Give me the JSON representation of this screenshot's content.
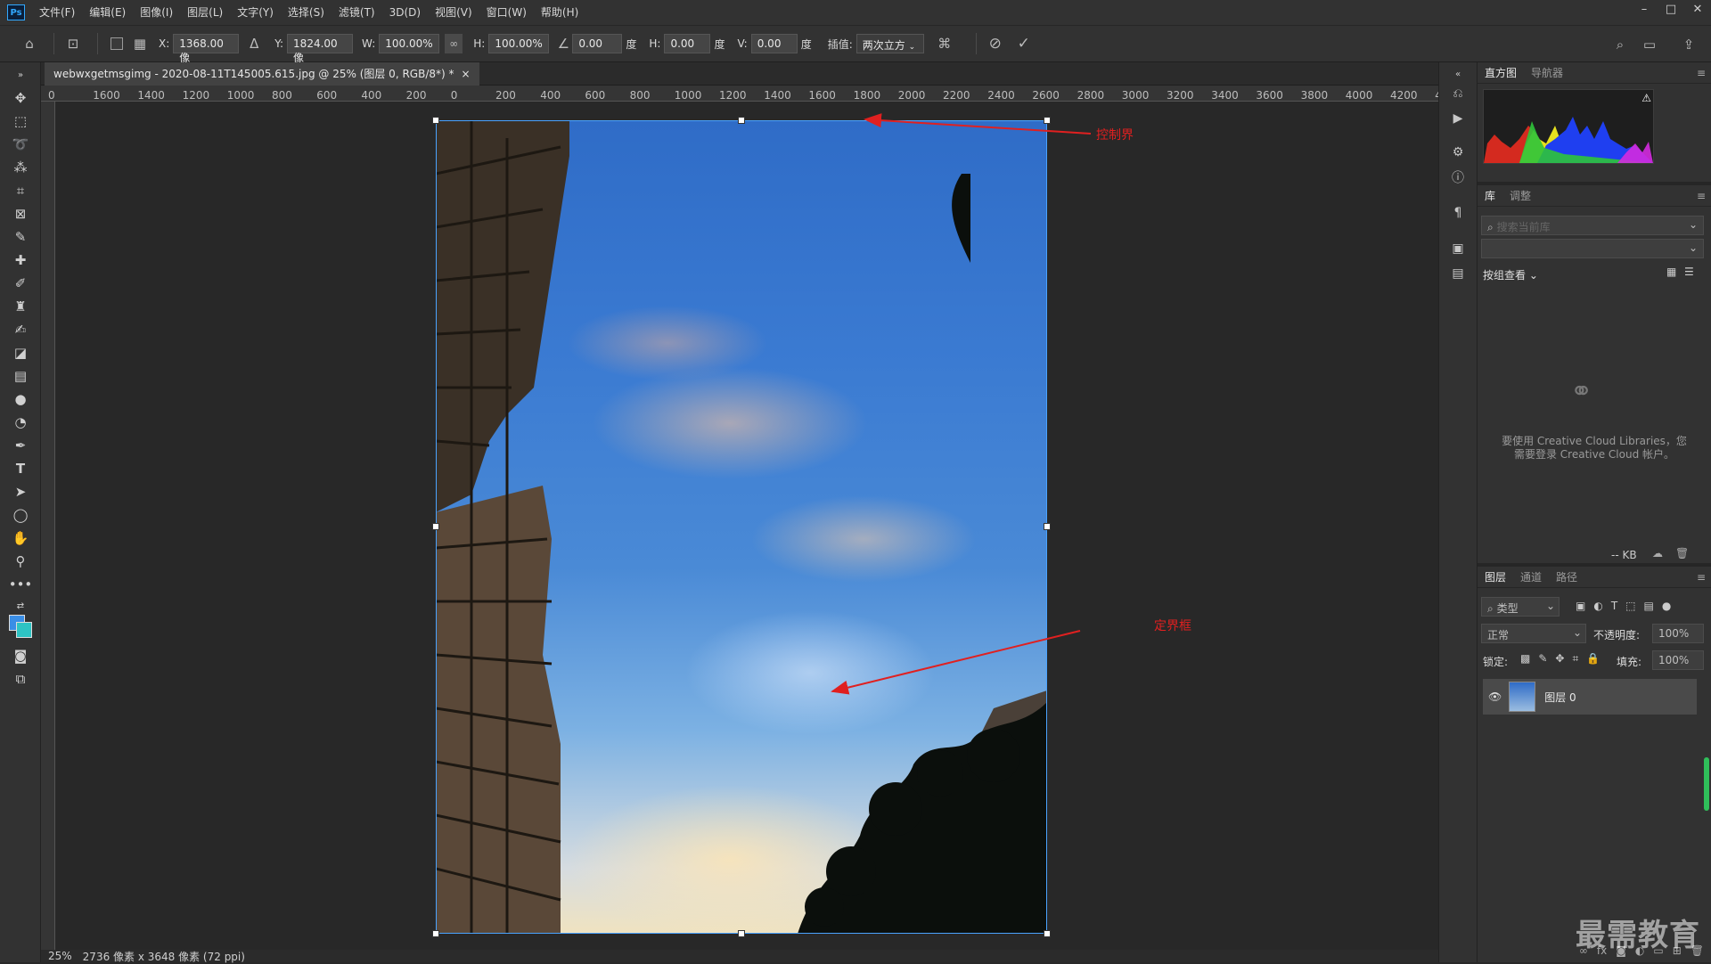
{
  "app": {
    "logo": "Ps"
  },
  "menu": [
    "文件(F)",
    "编辑(E)",
    "图像(I)",
    "图层(L)",
    "文字(Y)",
    "选择(S)",
    "滤镜(T)",
    "3D(D)",
    "视图(V)",
    "窗口(W)",
    "帮助(H)"
  ],
  "window_controls": {
    "minimize": "–",
    "maximize": "□",
    "close": "✕"
  },
  "options": {
    "x_label": "X:",
    "x_value": "1368.00 像",
    "y_label": "Y:",
    "y_value": "1824.00 像",
    "w_label": "W:",
    "w_value": "100.00%",
    "h_label": "H:",
    "h_value": "100.00%",
    "angle_value": "0.00",
    "angle_unit": "度",
    "hskew_label": "H:",
    "hskew_value": "0.00",
    "hskew_unit": "度",
    "vskew_label": "V:",
    "vskew_value": "0.00",
    "vskew_unit": "度",
    "interp_label": "插值:",
    "interp_value": "两次立方",
    "cancel_icon": "cancel-icon",
    "commit_icon": "checkmark-icon"
  },
  "document_tab": {
    "title": "webwxgetmsgimg - 2020-08-11T145005.615.jpg @ 25% (图层 0, RGB/8*) *",
    "close": "×"
  },
  "ruler_h": [
    "0",
    "1600",
    "1400",
    "1200",
    "1000",
    "800",
    "600",
    "400",
    "200",
    "0",
    "200",
    "400",
    "600",
    "800",
    "1000",
    "1200",
    "1400",
    "1600",
    "1800",
    "2000",
    "2200",
    "2400",
    "2600",
    "2800",
    "3000",
    "3200",
    "3400",
    "3600",
    "3800",
    "4000",
    "4200",
    "4"
  ],
  "annotations": {
    "control_bound": "控制界",
    "bounding_box": "定界框"
  },
  "panels": {
    "histogram_tabs": [
      "直方图",
      "导航器"
    ],
    "library_tabs": [
      "库",
      "调整"
    ],
    "library_search_placeholder": "搜索当前库",
    "group_view": "按组查看",
    "cc_message_1": "要使用 Creative Cloud Libraries，您",
    "cc_message_2": "需要登录 Creative Cloud 帐户。",
    "kb": "-- KB",
    "layers_tabs": [
      "图层",
      "通道",
      "路径"
    ],
    "filter_kind": "类型",
    "blend_mode": "正常",
    "opacity_label": "不透明度:",
    "opacity_value": "100%",
    "lock_label": "锁定:",
    "fill_label": "填充:",
    "fill_value": "100%",
    "layer_name": "图层 0"
  },
  "status": {
    "zoom": "25%",
    "doc_info": "2736 像素 x 3648 像素 (72 ppi)"
  },
  "watermark": "最需教育",
  "colors": {
    "accent": "#31a8ff",
    "annotation": "#e02020",
    "selection": "#4aa3ff"
  }
}
